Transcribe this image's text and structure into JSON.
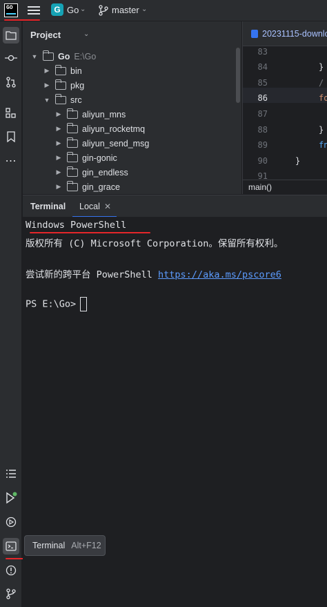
{
  "topbar": {
    "logo_text": "GO",
    "project_badge": "G",
    "project_name": "Go",
    "branch": "master"
  },
  "toolstrip": {
    "top": [
      "project-icon",
      "commit-icon",
      "pull-requests-icon",
      "structure-icon",
      "bookmarks-icon",
      "more-icon"
    ],
    "bottom": [
      "todo-icon",
      "run-icon",
      "services-icon",
      "terminal-icon",
      "problems-icon",
      "git-icon"
    ]
  },
  "project": {
    "title": "Project",
    "tree": [
      {
        "label": "Go",
        "sub": "E:\\Go",
        "expanded": true
      },
      {
        "label": "bin",
        "expanded": false
      },
      {
        "label": "pkg",
        "expanded": false
      },
      {
        "label": "src",
        "expanded": true
      },
      {
        "label": "aliyun_mns",
        "expanded": false
      },
      {
        "label": "aliyun_rocketmq",
        "expanded": false
      },
      {
        "label": "aliyun_send_msg",
        "expanded": false
      },
      {
        "label": "gin-gonic",
        "expanded": false
      },
      {
        "label": "gin_endless",
        "expanded": false
      },
      {
        "label": "gin_grace",
        "expanded": false
      }
    ]
  },
  "editor": {
    "tab_label": "20231115-downlo",
    "line_numbers": [
      "83",
      "84",
      "85",
      "86",
      "87",
      "88",
      "89",
      "90",
      "91"
    ],
    "current_line": "86",
    "code": [
      "",
      "}",
      "/",
      "fo",
      "",
      "}",
      "fn",
      "}",
      ""
    ],
    "breadcrumb": "main()"
  },
  "terminal": {
    "title": "Terminal",
    "tab_label": "Local",
    "lines": [
      "Windows PowerShell",
      "版权所有 (C) Microsoft Corporation。保留所有权利。",
      "",
      "尝试新的跨平台 PowerShell "
    ],
    "link": "https://aka.ms/pscore6",
    "prompt": "PS E:\\Go>"
  },
  "tooltip": {
    "label": "Terminal",
    "shortcut": "Alt+F12"
  },
  "colors": {
    "annotation_red": "#e5262a",
    "accent_blue": "#3574f0",
    "link_blue": "#5c9cff",
    "badge_teal": "#16a3b5"
  }
}
